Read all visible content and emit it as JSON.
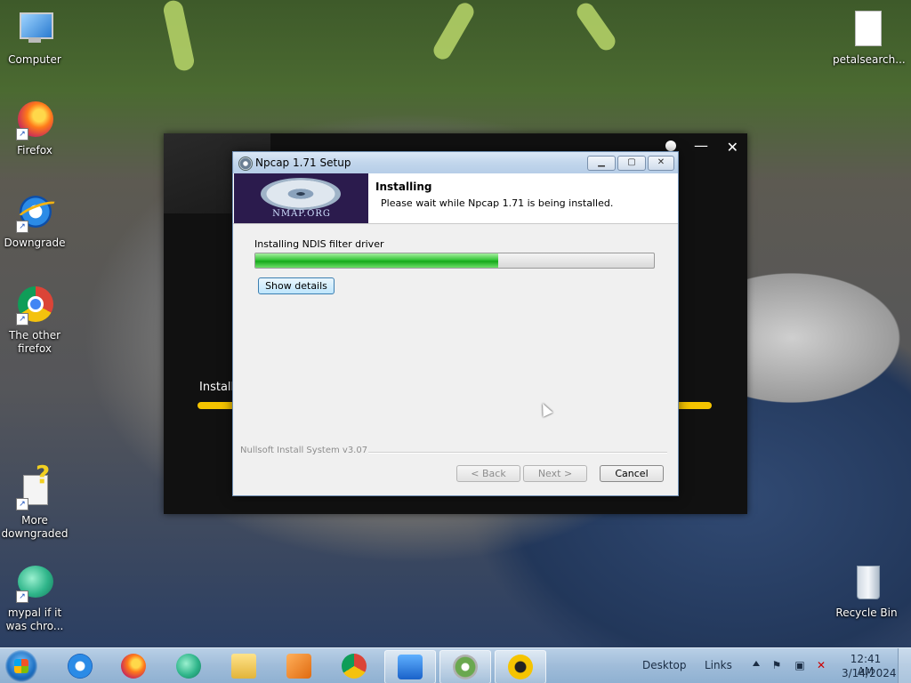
{
  "desktop": {
    "icons": [
      {
        "label": "Computer"
      },
      {
        "label": "Firefox"
      },
      {
        "label": "Downgrade"
      },
      {
        "label": "The other firefox"
      },
      {
        "label": "More downgraded"
      },
      {
        "label": "mypal if it was chro..."
      },
      {
        "label": "petalsearch..."
      },
      {
        "label": "Recycle Bin"
      }
    ]
  },
  "background_installer": {
    "label": "Installi",
    "progress": 1.0
  },
  "dialog": {
    "title": "Npcap 1.71 Setup",
    "logo_text": "NMAP.ORG",
    "header_title": "Installing",
    "header_subtitle": "Please wait while Npcap 1.71 is being installed.",
    "status": "Installing NDIS filter driver",
    "progress": 0.61,
    "show_details": "Show details",
    "brand": "Nullsoft Install System v3.07",
    "back": "< Back",
    "next": "Next >",
    "cancel": "Cancel"
  },
  "taskbar": {
    "desktop_label": "Desktop",
    "links_label": "Links",
    "time": "12:41 AM",
    "date": "3/14/2024"
  },
  "colors": {
    "accent": "#3c7fb1",
    "progress_green": "#16a81a",
    "bg_progress_yellow": "#f5c400"
  }
}
